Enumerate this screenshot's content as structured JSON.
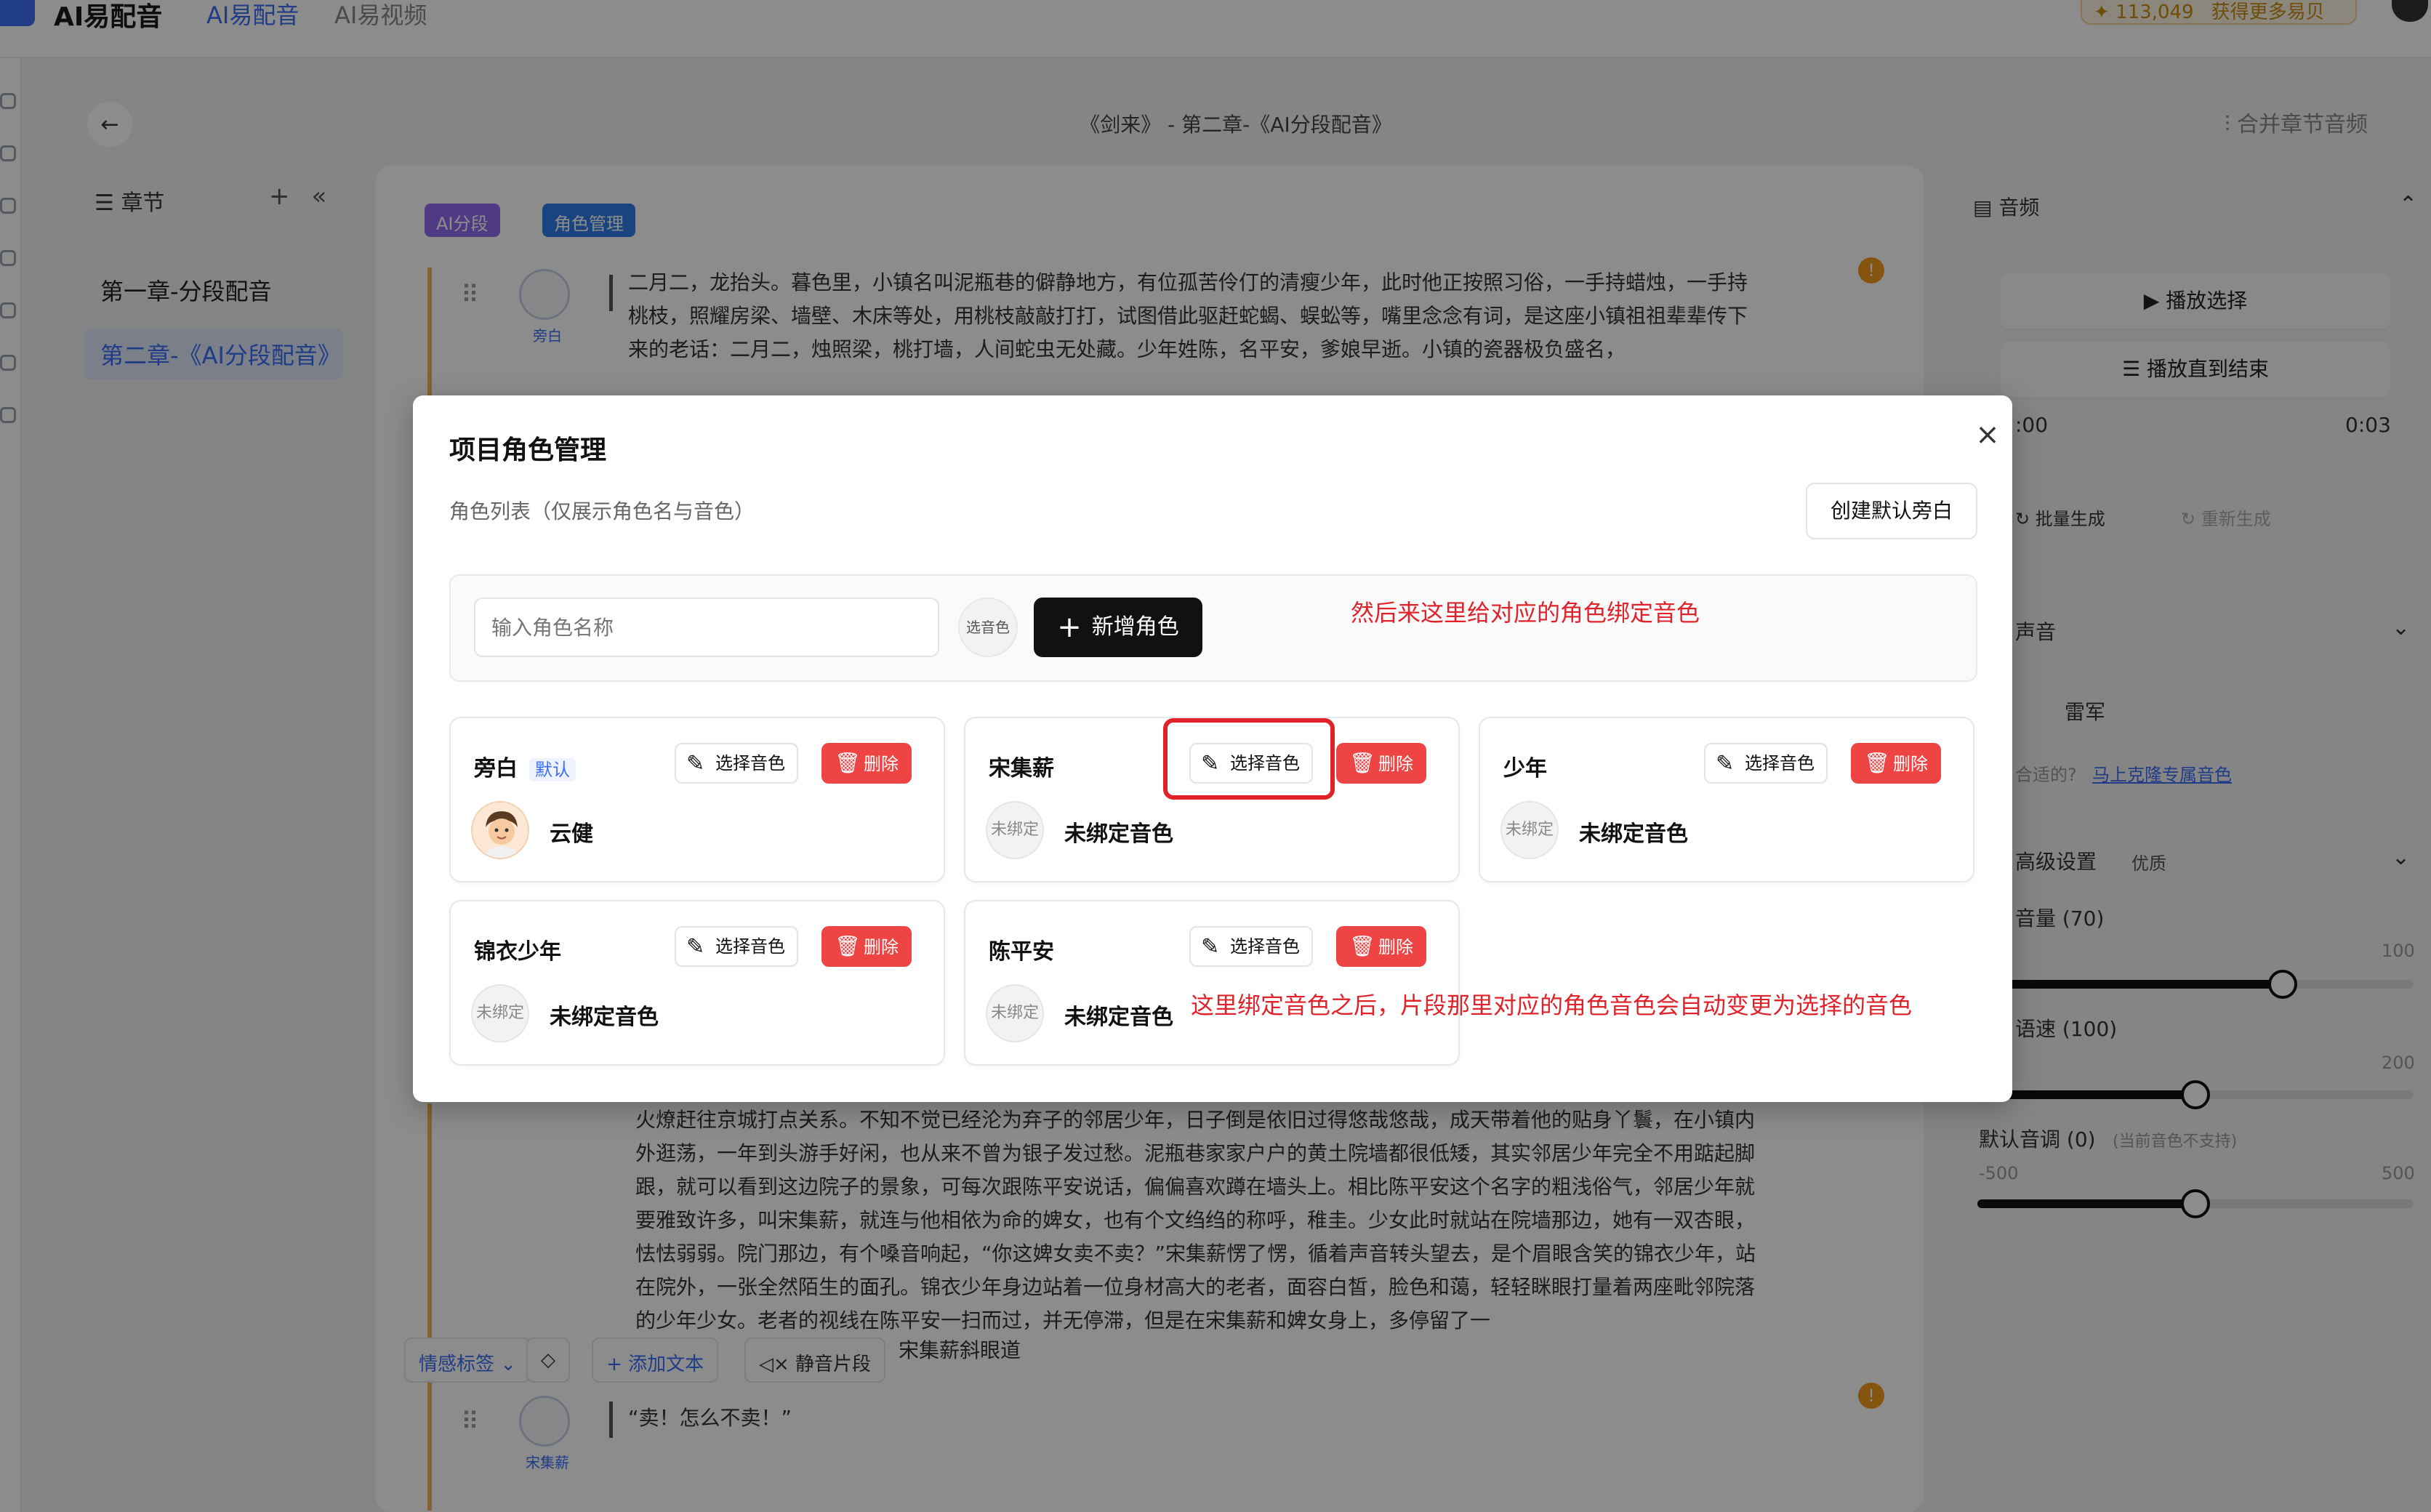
{
  "app": {
    "brand": "AI易配音",
    "nav": [
      "AI易配音",
      "AI易视频"
    ],
    "credits": "113,049",
    "credits_more": "获得更多易贝"
  },
  "header": {
    "title": "《剑来》 - 第二章-《AI分段配音》",
    "merge_button": "合并章节音频"
  },
  "chapters": {
    "heading": "章节",
    "items": [
      "第一章-分段配音",
      "第二章-《AI分段配音》"
    ]
  },
  "editor": {
    "tags": [
      "AI分段",
      "角色管理"
    ],
    "segments": [
      {
        "speaker": "旁白",
        "text": "二月二，龙抬头。暮色里，小镇名叫泥瓶巷的僻静地方，有位孤苦伶仃的清瘦少年，此时他正按照习俗，一手持蜡烛，一手持桃枝，照耀房梁、墙壁、木床等处，用桃枝敲敲打打，试图借此驱赶蛇蝎、蜈蚣等，嘴里念念有词，是这座小镇祖祖辈辈传下来的老话：二月二，烛照梁，桃打墙，人间蛇虫无处藏。少年姓陈，名平安，爹娘早逝。小镇的瓷器极负盛名，"
      },
      {
        "speaker": "",
        "text": "火燎赶往京城打点关系。不知不觉已经沦为弃子的邻居少年，日子倒是依旧过得悠哉悠哉，成天带着他的贴身丫鬟，在小镇内外逛荡，一年到头游手好闲，也从来不曾为银子发过愁。泥瓶巷家家户户的黄土院墙都很低矮，其实邻居少年完全不用踮起脚跟，就可以看到这边院子的景象，可每次跟陈平安说话，偏偏喜欢蹲在墙头上。相比陈平安这个名字的粗浅俗气，邻居少年就要雅致许多，叫宋集薪，就连与他相依为命的婢女，也有个文绉绉的称呼，稚圭。少女此时就站在院墙那边，她有一双杏眼，怯怯弱弱。院门那边，有个嗓音响起，“你这婢女卖不卖？”宋集薪愣了愣，循着声音转头望去，是个眉眼含笑的锦衣少年，站在院外，一张全然陌生的面孔。锦衣少年身边站着一位身材高大的老者，面容白皙，脸色和蔼，轻轻眯眼打量着两座毗邻院落的少年少女。老者的视线在陈平安一扫而过，并无停滞，但是在宋集薪和婢女身上，多停留了一"
      },
      {
        "speaker": "宋集薪",
        "text": "“卖！怎么不卖！”"
      }
    ],
    "toolbar": [
      "情感标签",
      "添加文本",
      "静音片段"
    ],
    "partial_line": "宋集薪斜眼道"
  },
  "right_panel": {
    "audio_title": "音频",
    "play_selection": "播放选择",
    "play_to_end": "播放直到结束",
    "time_start": ":00",
    "time_end": "0:03",
    "batch_generate": "批量生成",
    "regenerate": "重新生成",
    "voice_title": "声音",
    "voice_name": "雷军",
    "voice_hint": "合适的?",
    "voice_clone_link": "马上克隆专属音色",
    "advanced_title": "高级设置",
    "advanced_quality": "优质",
    "volume_label": "音量 (70)",
    "volume_max": "100",
    "volume_value": 70,
    "speed_label": "语速 (100)",
    "speed_max": "200",
    "speed_value": 100,
    "pitch_label": "默认音调 (0)",
    "pitch_note": "(当前音色不支持)",
    "pitch_min": "-500",
    "pitch_max": "500",
    "pitch_value": 0
  },
  "modal": {
    "title": "项目角色管理",
    "subtitle": "角色列表（仅展示角色名与音色）",
    "create_default_narrator": "创建默认旁白",
    "name_input_placeholder": "输入角色名称",
    "pick_voice_small": "选音色",
    "add_role_button": "新增角色",
    "annotation_top": "然后来这里给对应的角色绑定音色",
    "annotation_bottom": "这里绑定音色之后，片段那里对应的角色音色会自动变更为选择的音色",
    "pick_voice_label": "选择音色",
    "delete_label": "删除",
    "default_badge": "默认",
    "unbound_avatar": "未绑定",
    "roles": [
      {
        "name": "旁白",
        "is_default": true,
        "voice": "云健"
      },
      {
        "name": "宋集薪",
        "is_default": false,
        "voice": "未绑定音色"
      },
      {
        "name": "少年",
        "is_default": false,
        "voice": "未绑定音色"
      },
      {
        "name": "锦衣少年",
        "is_default": false,
        "voice": "未绑定音色"
      },
      {
        "name": "陈平安",
        "is_default": false,
        "voice": "未绑定音色"
      }
    ]
  },
  "colors": {
    "accent": "#3b6ef5",
    "danger": "#ef4444",
    "annotation": "#e0232a",
    "primary_button": "#111111"
  },
  "icons": [
    "close-icon",
    "plus-icon",
    "pencil-icon",
    "trash-icon",
    "back-arrow-icon",
    "play-icon",
    "list-icon"
  ]
}
